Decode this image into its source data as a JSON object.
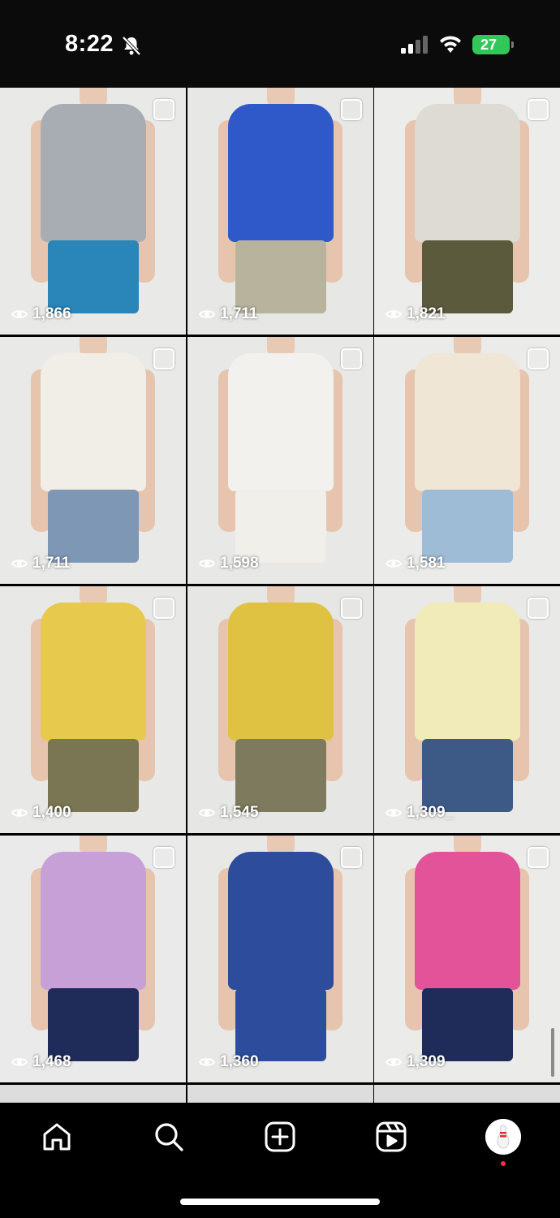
{
  "status_bar": {
    "time": "8:22",
    "battery": "27"
  },
  "posts": [
    {
      "views": "1,866",
      "bg": "#e9e9e7",
      "top": "#a8adb4",
      "bottom": "#2a86b8"
    },
    {
      "views": "1,711",
      "bg": "#e7e7e5",
      "top": "#2f58c8",
      "bottom": "#b7b39c"
    },
    {
      "views": "1,821",
      "bg": "#ececea",
      "top": "#dedad4",
      "bottom": "#5c5a3c"
    },
    {
      "views": "1,711",
      "bg": "#e9e9e7",
      "top": "#f1eee8",
      "bottom": "#7d97b4"
    },
    {
      "views": "1,598",
      "bg": "#e8e8e6",
      "top": "#f2f1ed",
      "bottom": "#f0efea"
    },
    {
      "views": "1,581",
      "bg": "#ebebe9",
      "top": "#efe6d6",
      "bottom": "#9fbcd6"
    },
    {
      "views": "1,400",
      "bg": "#e8e8e6",
      "top": "#e6c94d",
      "bottom": "#7a7552"
    },
    {
      "views": "1,545",
      "bg": "#e6e6e4",
      "top": "#e0c243",
      "bottom": "#7d7a5e"
    },
    {
      "views": "1,309_",
      "bg": "#e9e9e7",
      "top": "#f0ebb8",
      "bottom": "#3d5a86"
    },
    {
      "views": "1,468",
      "bg": "#eaeaea",
      "top": "#c7a0d8",
      "bottom": "#1f2c5a"
    },
    {
      "views": "1,360",
      "bg": "#e8e8e6",
      "top": "#2d4d9c",
      "bottom": "#2d4d9c"
    },
    {
      "views": "1,309",
      "bg": "#ebebe9",
      "top": "#e2539a",
      "bottom": "#1f2c5a"
    }
  ],
  "nav": [
    "home-icon",
    "search-icon",
    "create-icon",
    "reels-icon",
    "profile-avatar"
  ]
}
